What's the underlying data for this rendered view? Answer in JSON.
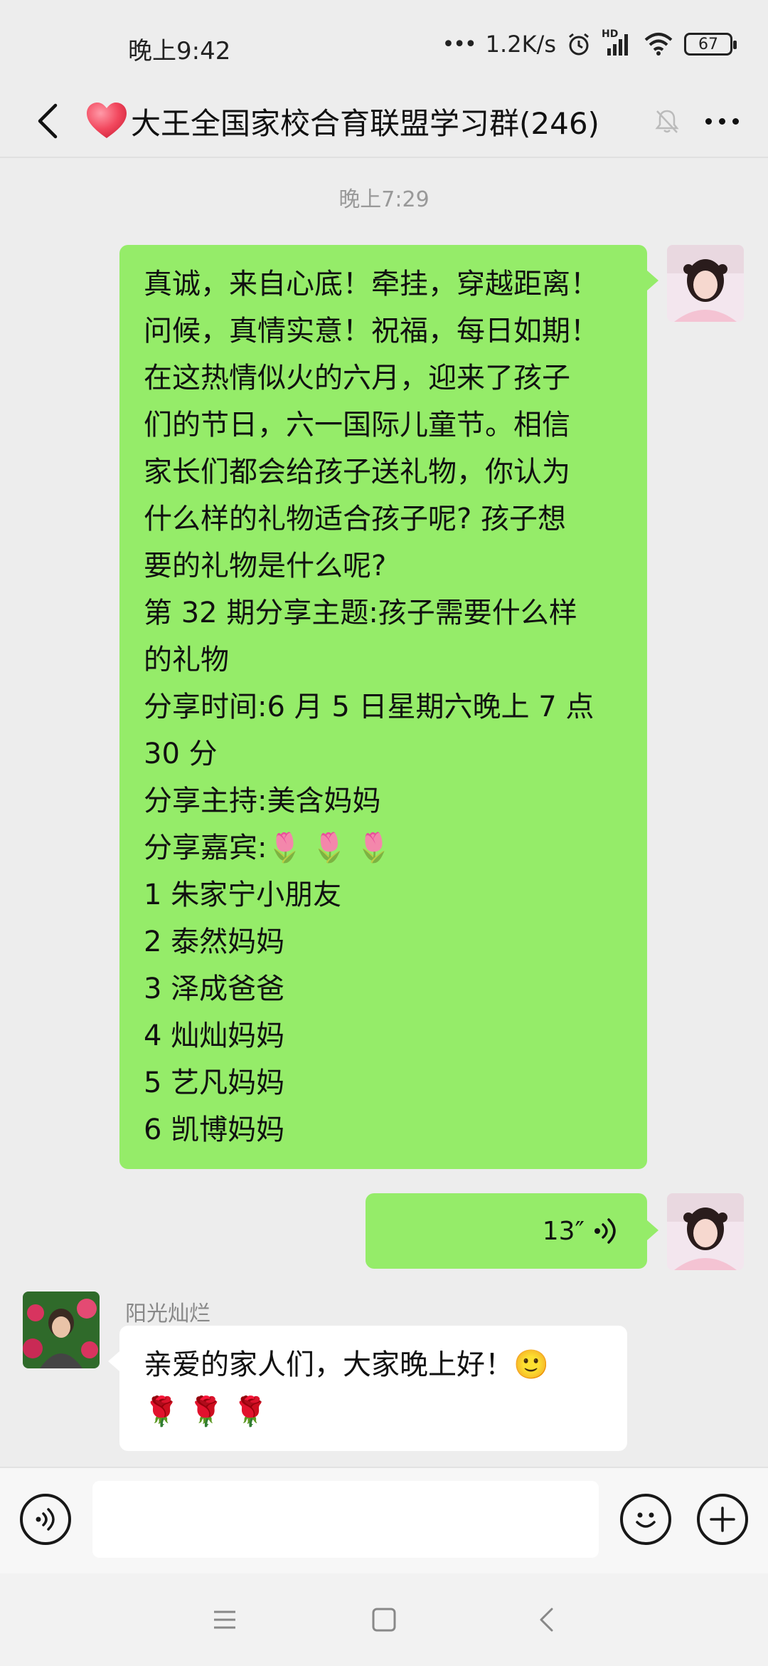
{
  "status_bar": {
    "time": "晚上9:42",
    "network_speed": "1.2K/s",
    "hd_label": "HD",
    "battery": "67"
  },
  "header": {
    "title": "大王全国家校合育联盟学习群(246)"
  },
  "chat": {
    "timestamp": "晚上7:29",
    "messages": [
      {
        "lines": [
          "真诚，来自心底！牵挂，穿越距离！",
          "问候，真情实意！祝福，每日如期！",
          "在这热情似火的六月，迎来了孩子",
          "们的节日，六一国际儿童节。相信",
          "家长们都会给孩子送礼物，你认为",
          "什么样的礼物适合孩子呢? 孩子想",
          "要的礼物是什么呢?",
          "第 32 期分享主题:孩子需要什么样",
          "的礼物",
          "分享时间:6 月 5 日星期六晚上 7 点",
          "30 分",
          "分享主持:美含妈妈",
          "分享嘉宾:🌷 🌷 🌷",
          "1 朱家宁小朋友",
          "2 泰然妈妈",
          "3 泽成爸爸",
          "4 灿灿妈妈",
          "5 艺凡妈妈",
          "6 凯博妈妈"
        ]
      },
      {
        "voice_duration": "13″"
      },
      {
        "sender": "阳光灿烂",
        "lines": [
          "亲爱的家人们，大家晚上好！🙂",
          "🌹 🌹 🌹"
        ]
      }
    ]
  },
  "input": {
    "placeholder": ""
  },
  "icons": {
    "back": "back-arrow-icon",
    "heart": "heart-icon",
    "mute": "mute-bell-icon",
    "more": "more-dots-icon",
    "voice": "voice-toggle-icon",
    "emoji": "emoji-icon",
    "add": "add-icon"
  },
  "colors": {
    "self_bubble": "#95ec69",
    "other_bubble": "#ffffff",
    "background": "#ededed"
  }
}
